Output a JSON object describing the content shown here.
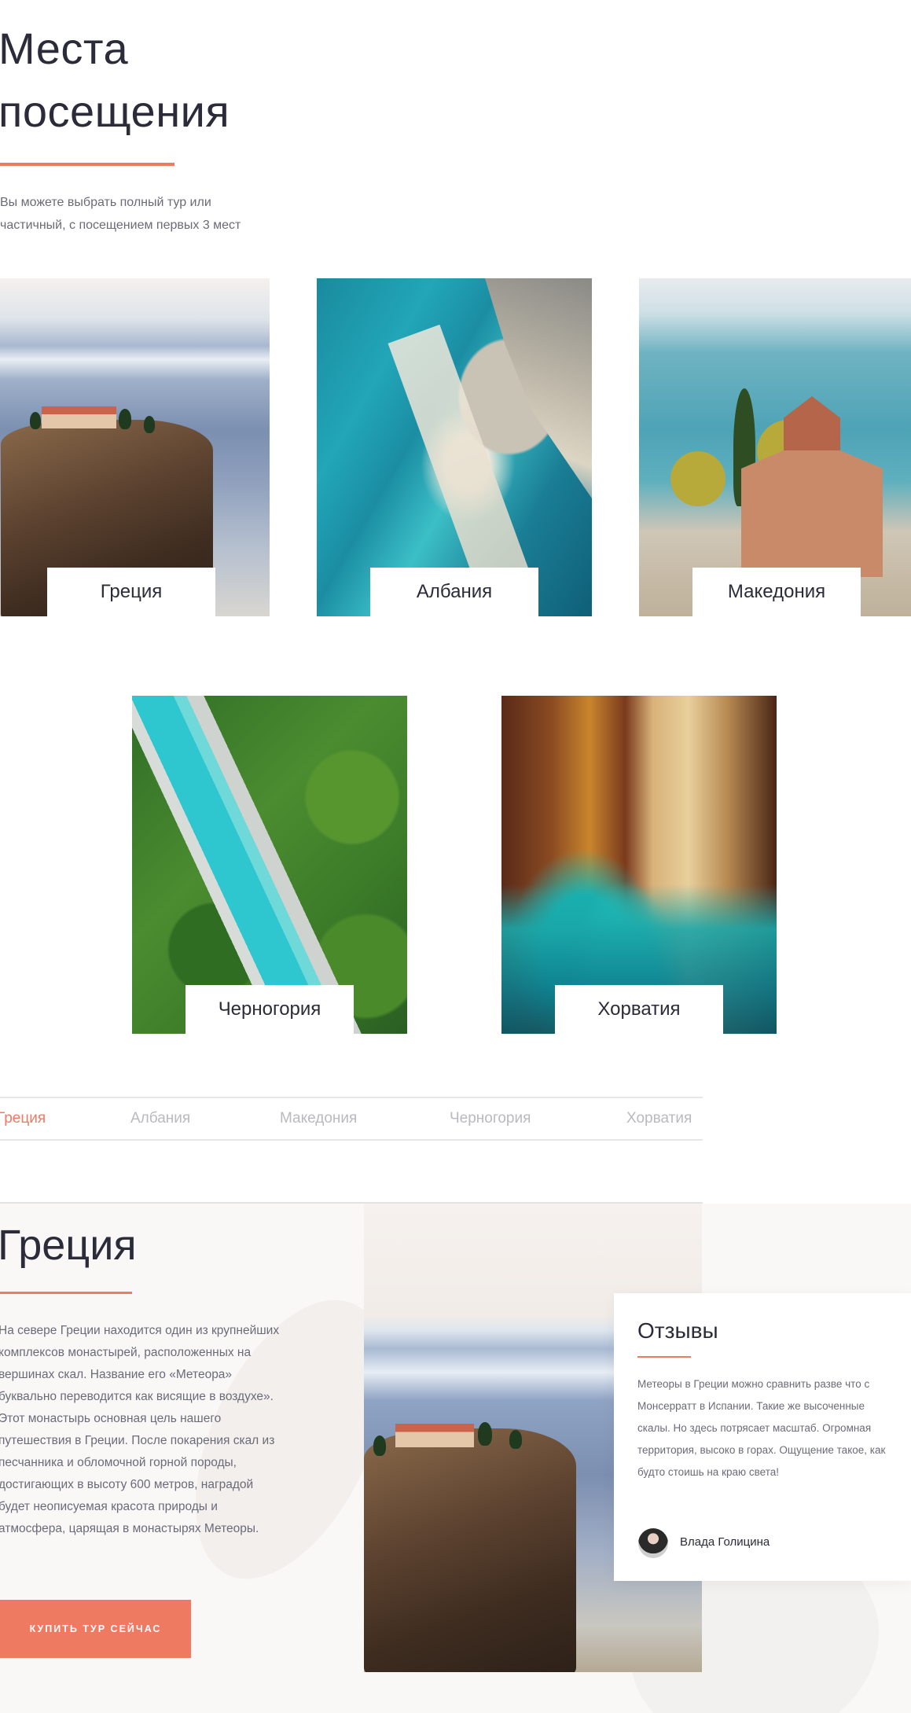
{
  "header": {
    "title_line1": "Места",
    "title_line2": "посещения",
    "subtitle": "Вы можете выбрать полный тур или частичный, с посещением первых 3 мест"
  },
  "destinations": [
    {
      "label": "Греция"
    },
    {
      "label": "Албания"
    },
    {
      "label": "Македония"
    },
    {
      "label": "Черногория"
    },
    {
      "label": "Хорватия"
    }
  ],
  "tabs": [
    {
      "label": "Греция",
      "active": true
    },
    {
      "label": "Албания",
      "active": false
    },
    {
      "label": "Македония",
      "active": false
    },
    {
      "label": "Черногория",
      "active": false
    },
    {
      "label": "Хорватия",
      "active": false
    }
  ],
  "detail": {
    "title": "Греция",
    "description": "На севере Греции находится один из крупнейших комплексов монастырей, расположенных на вершинах скал. Название его «Метеора» буквально переводится как висящие в воздухе». Этот монастырь основная цель нашего путешествия в Греции. После покарения скал из песчанника и обломочной горной породы, достигающих в высоту 600 метров, наградой будет неописуемая красота природы и атмосфера, царящая в монастырях Метеоры.",
    "buy_button": "КУПИТЬ ТУР СЕЙЧАС"
  },
  "review": {
    "title": "Отзывы",
    "text": "Метеоры в Греции можно сравнить разве что с Монсерратт в Испании. Такие же высоченные скалы. Но здесь потрясает масштаб. Огромная территория, высоко в горах. Ощущение такое, как будто стоишь на краю света!",
    "author": "Влада Голицина"
  },
  "colors": {
    "accent": "#ef7a62",
    "heading": "#2b2b3a",
    "body_text": "#6b6b78",
    "tab_inactive": "#b9b9c0"
  }
}
